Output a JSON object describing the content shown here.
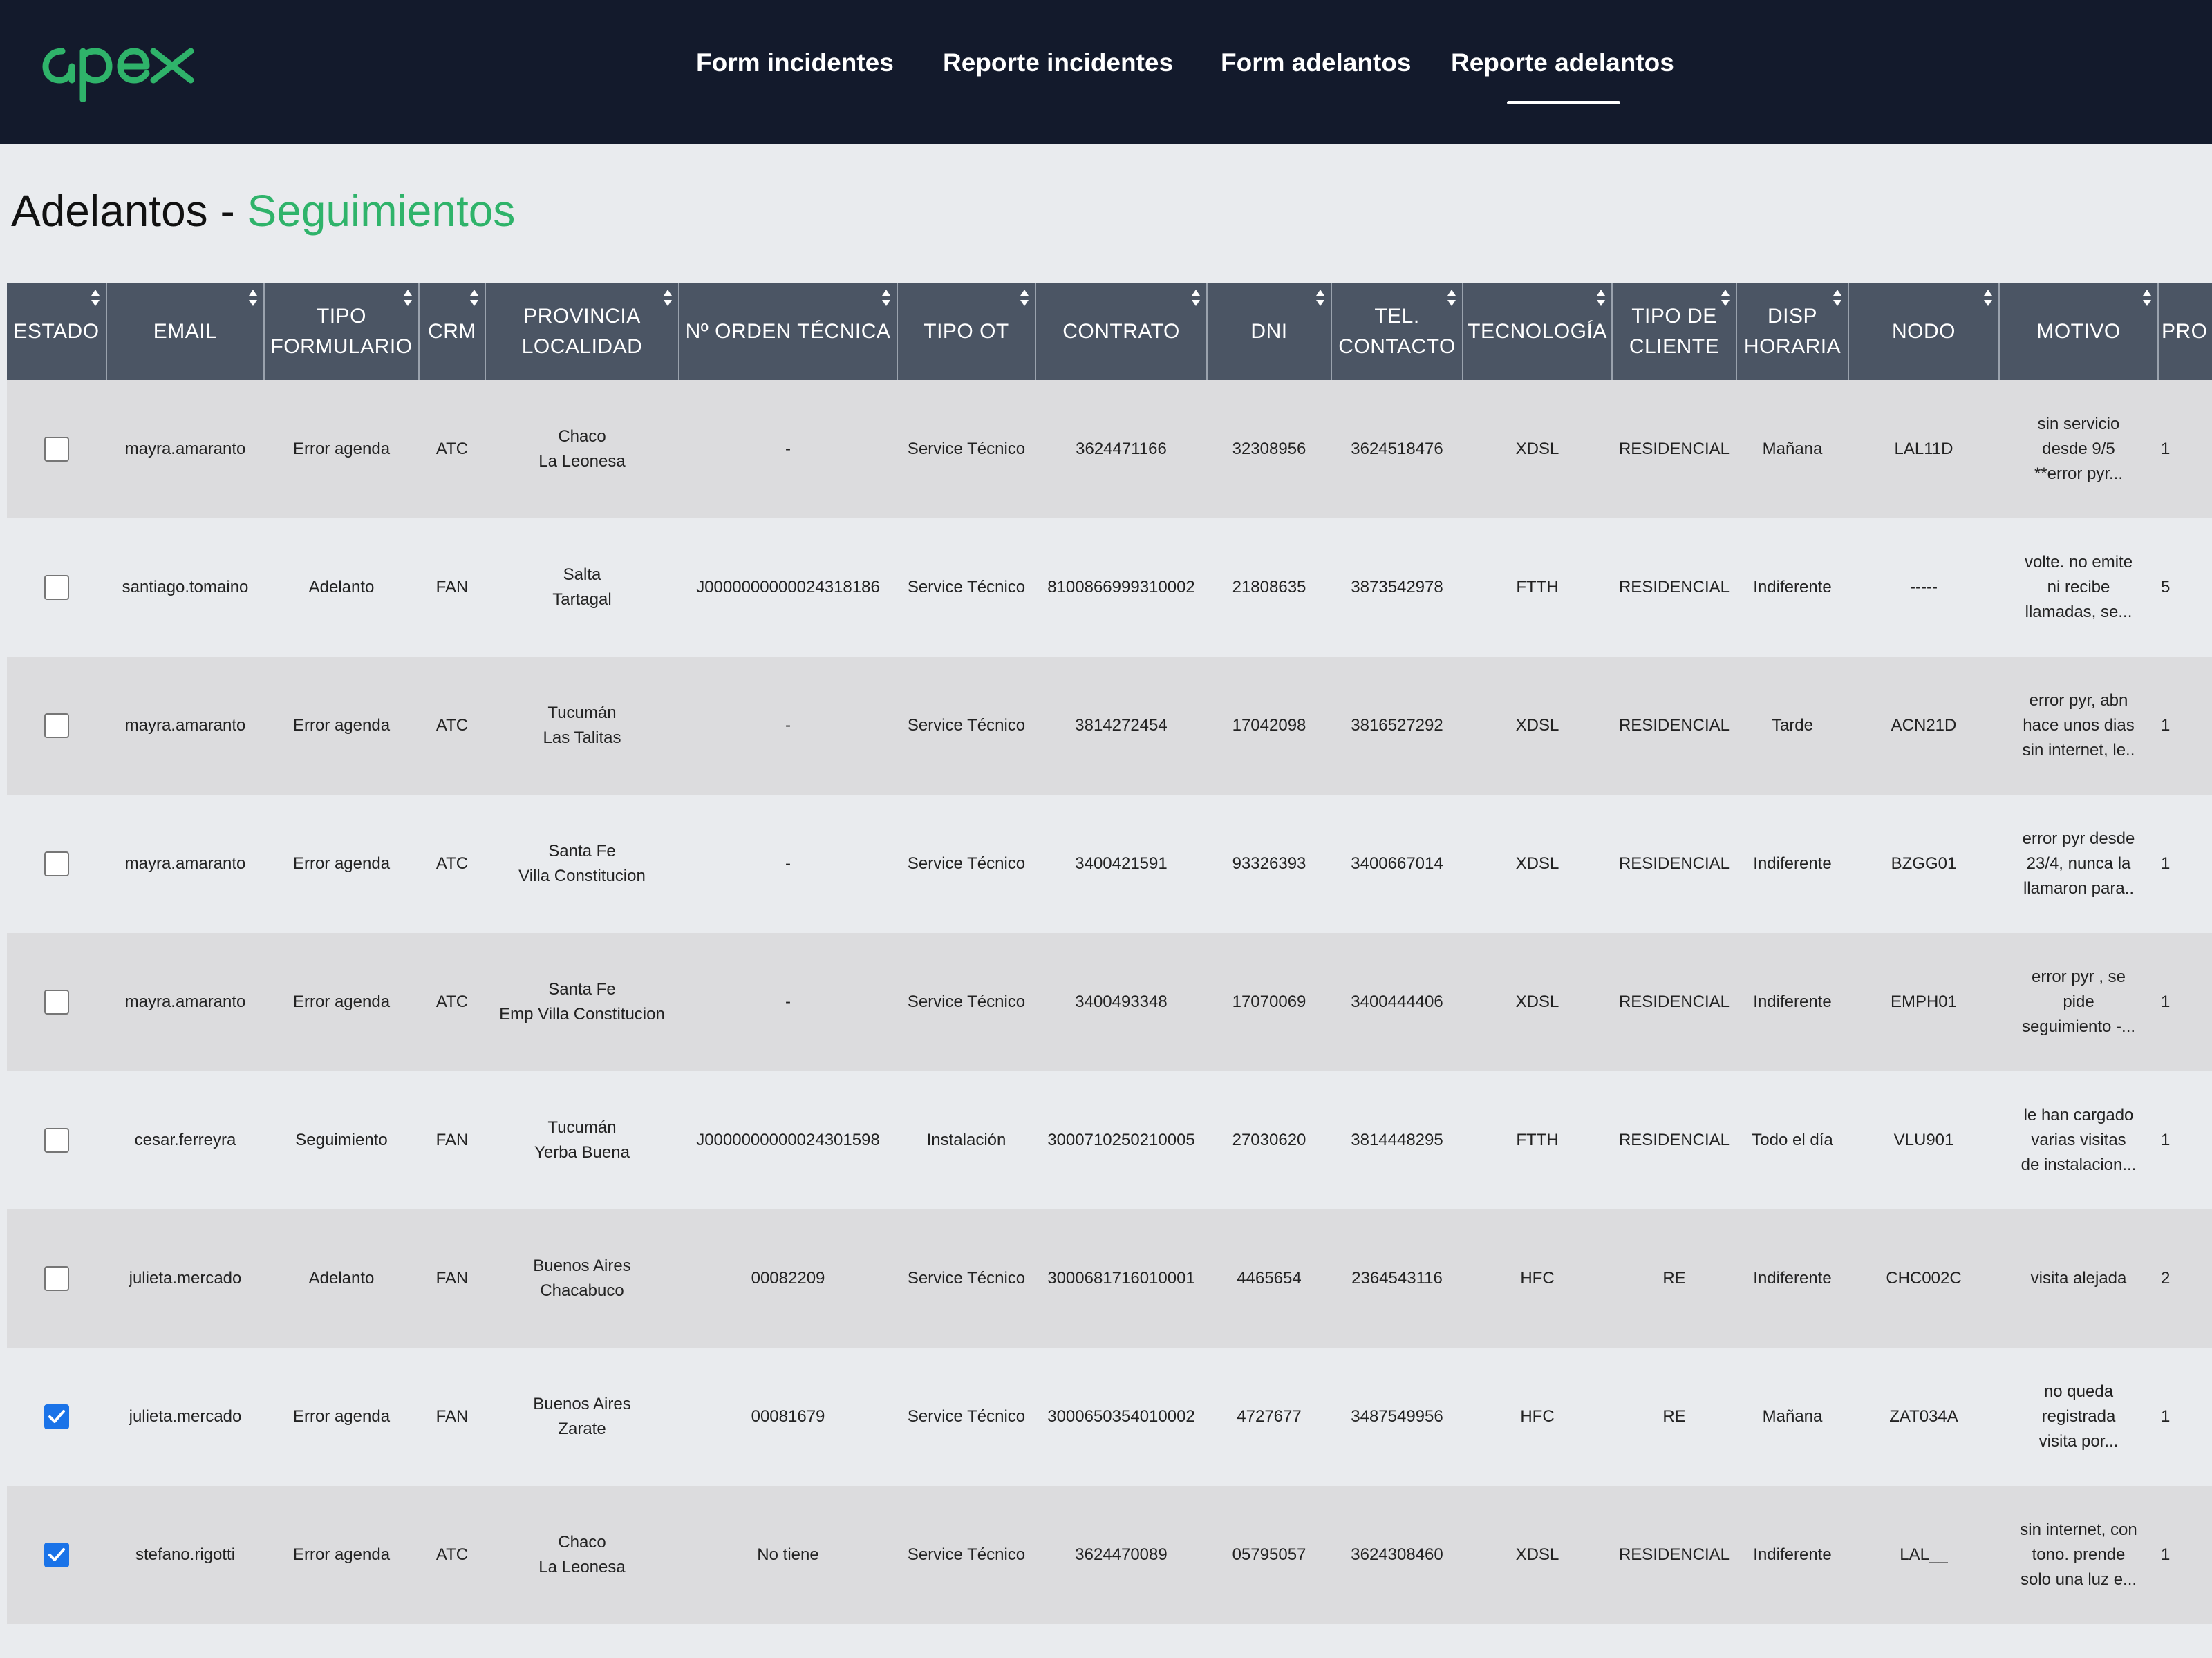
{
  "brand": {
    "logo_text": "apex",
    "accent_color": "#2fb36a",
    "nav_bg": "#131a2c"
  },
  "nav": {
    "items": [
      {
        "label": "Form incidentes",
        "active": false
      },
      {
        "label": "Reporte incidentes",
        "active": false
      },
      {
        "label": "Form adelantos",
        "active": false
      },
      {
        "label": "Reporte adelantos",
        "active": true
      }
    ]
  },
  "page": {
    "title_main": "Adelantos - ",
    "title_accent": "Seguimientos"
  },
  "table": {
    "columns": [
      {
        "label": "ESTADO"
      },
      {
        "label": "EMAIL"
      },
      {
        "label": "TIPO FORMULARIO"
      },
      {
        "label": "CRM"
      },
      {
        "label": "PROVINCIA LOCALIDAD"
      },
      {
        "label": "Nº ORDEN TÉCNICA"
      },
      {
        "label": "TIPO OT"
      },
      {
        "label": "CONTRATO"
      },
      {
        "label": "DNI"
      },
      {
        "label": "TEL. CONTACTO"
      },
      {
        "label": "TECNOLOGÍA"
      },
      {
        "label": "TIPO DE CLIENTE"
      },
      {
        "label": "DISP HORARIA"
      },
      {
        "label": "NODO"
      },
      {
        "label": "MOTIVO"
      },
      {
        "label": "PRO"
      }
    ],
    "rows": [
      {
        "checked": false,
        "email": "mayra.amaranto",
        "tipo": "Error agenda",
        "crm": "ATC",
        "provincia": "Chaco",
        "localidad": "La Leonesa",
        "orden": "-",
        "tipo_ot": "Service Técnico",
        "contrato": "3624471166",
        "dni": "32308956",
        "tel": "3624518476",
        "tecnologia": "XDSL",
        "cliente": "RESIDENCIAL",
        "disp": "Mañana",
        "nodo": "LAL11D",
        "motivo": [
          "sin servicio",
          "desde 9/5",
          "**error pyr..."
        ],
        "pro": "1"
      },
      {
        "checked": false,
        "email": "santiago.tomaino",
        "tipo": "Adelanto",
        "crm": "FAN",
        "provincia": "Salta",
        "localidad": "Tartagal",
        "orden": "J0000000000024318186",
        "tipo_ot": "Service Técnico",
        "contrato": "8100866999310002",
        "dni": "21808635",
        "tel": "3873542978",
        "tecnologia": "FTTH",
        "cliente": "RESIDENCIAL",
        "disp": "Indiferente",
        "nodo": "-----",
        "motivo": [
          "volte. no emite",
          "ni recibe",
          "llamadas, se..."
        ],
        "pro": "5"
      },
      {
        "checked": false,
        "email": "mayra.amaranto",
        "tipo": "Error agenda",
        "crm": "ATC",
        "provincia": "Tucumán",
        "localidad": "Las Talitas",
        "orden": "-",
        "tipo_ot": "Service Técnico",
        "contrato": "3814272454",
        "dni": "17042098",
        "tel": "3816527292",
        "tecnologia": "XDSL",
        "cliente": "RESIDENCIAL",
        "disp": "Tarde",
        "nodo": "ACN21D",
        "motivo": [
          "error pyr, abn",
          "hace unos dias",
          "sin internet, le.."
        ],
        "pro": "1"
      },
      {
        "checked": false,
        "email": "mayra.amaranto",
        "tipo": "Error agenda",
        "crm": "ATC",
        "provincia": "Santa Fe",
        "localidad": "Villa Constitucion",
        "orden": "-",
        "tipo_ot": "Service Técnico",
        "contrato": "3400421591",
        "dni": "93326393",
        "tel": "3400667014",
        "tecnologia": "XDSL",
        "cliente": "RESIDENCIAL",
        "disp": "Indiferente",
        "nodo": "BZGG01",
        "motivo": [
          "error pyr desde",
          "23/4, nunca la",
          "llamaron para.."
        ],
        "pro": "1"
      },
      {
        "checked": false,
        "email": "mayra.amaranto",
        "tipo": "Error agenda",
        "crm": "ATC",
        "provincia": "Santa Fe",
        "localidad": "Emp Villa Constitucion",
        "orden": "-",
        "tipo_ot": "Service Técnico",
        "contrato": "3400493348",
        "dni": "17070069",
        "tel": "3400444406",
        "tecnologia": "XDSL",
        "cliente": "RESIDENCIAL",
        "disp": "Indiferente",
        "nodo": "EMPH01",
        "motivo": [
          "error pyr , se",
          "pide",
          "seguimiento -..."
        ],
        "pro": "1"
      },
      {
        "checked": false,
        "email": "cesar.ferreyra",
        "tipo": "Seguimiento",
        "crm": "FAN",
        "provincia": "Tucumán",
        "localidad": "Yerba Buena",
        "orden": "J0000000000024301598",
        "tipo_ot": "Instalación",
        "contrato": "3000710250210005",
        "dni": "27030620",
        "tel": "3814448295",
        "tecnologia": "FTTH",
        "cliente": "RESIDENCIAL",
        "disp": "Todo el día",
        "nodo": "VLU901",
        "motivo": [
          "le han cargado",
          "varias visitas",
          "de instalacion..."
        ],
        "pro": "1"
      },
      {
        "checked": false,
        "email": "julieta.mercado",
        "tipo": "Adelanto",
        "crm": "FAN",
        "provincia": "Buenos Aires",
        "localidad": "Chacabuco",
        "orden": "00082209",
        "tipo_ot": "Service Técnico",
        "contrato": "3000681716010001",
        "dni": "4465654",
        "tel": "2364543116",
        "tecnologia": "HFC",
        "cliente": "RE",
        "disp": "Indiferente",
        "nodo": "CHC002C",
        "motivo": [
          "visita alejada"
        ],
        "pro": "2"
      },
      {
        "checked": true,
        "email": "julieta.mercado",
        "tipo": "Error agenda",
        "crm": "FAN",
        "provincia": "Buenos Aires",
        "localidad": "Zarate",
        "orden": "00081679",
        "tipo_ot": "Service Técnico",
        "contrato": "3000650354010002",
        "dni": "4727677",
        "tel": "3487549956",
        "tecnologia": "HFC",
        "cliente": "RE",
        "disp": "Mañana",
        "nodo": "ZAT034A",
        "motivo": [
          "no queda",
          "registrada",
          "visita por..."
        ],
        "pro": "1"
      },
      {
        "checked": true,
        "email": "stefano.rigotti",
        "tipo": "Error agenda",
        "crm": "ATC",
        "provincia": "Chaco",
        "localidad": "La Leonesa",
        "orden": "No tiene",
        "tipo_ot": "Service Técnico",
        "contrato": "3624470089",
        "dni": "05795057",
        "tel": "3624308460",
        "tecnologia": "XDSL",
        "cliente": "RESIDENCIAL",
        "disp": "Indiferente",
        "nodo": "LAL__",
        "motivo": [
          "sin internet, con",
          "tono. prende",
          "solo una luz e..."
        ],
        "pro": "1"
      }
    ]
  }
}
